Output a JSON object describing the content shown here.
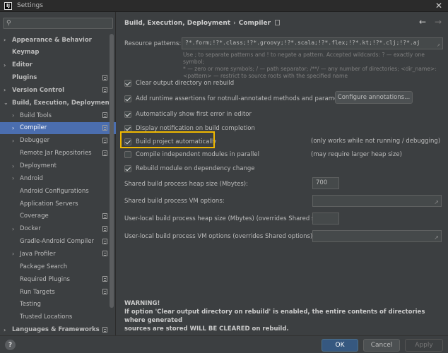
{
  "window": {
    "title": "Settings",
    "app_icon": "intellij-logo-icon",
    "app_icon_letter": "IJ",
    "close_glyph": "✕"
  },
  "sidebar": {
    "search_placeholder": "",
    "items": [
      {
        "label": "Appearance & Behavior",
        "bold": true,
        "arrow": "›"
      },
      {
        "label": "Keymap",
        "bold": true,
        "arrow": ""
      },
      {
        "label": "Editor",
        "bold": true,
        "arrow": "›"
      },
      {
        "label": "Plugins",
        "bold": true,
        "arrow": ""
      },
      {
        "label": "Version Control",
        "bold": true,
        "arrow": "›"
      },
      {
        "label": "Build, Execution, Deployment",
        "bold": true,
        "arrow": "⌄"
      },
      {
        "label": "Build Tools",
        "arrow": "›"
      },
      {
        "label": "Compiler",
        "arrow": "›",
        "selected": true
      },
      {
        "label": "Debugger",
        "arrow": "›"
      },
      {
        "label": "Remote Jar Repositories",
        "arrow": ""
      },
      {
        "label": "Deployment",
        "arrow": "›"
      },
      {
        "label": "Android",
        "arrow": "›"
      },
      {
        "label": "Android Configurations",
        "arrow": ""
      },
      {
        "label": "Application Servers",
        "arrow": ""
      },
      {
        "label": "Coverage",
        "arrow": ""
      },
      {
        "label": "Docker",
        "arrow": "›"
      },
      {
        "label": "Gradle-Android Compiler",
        "arrow": ""
      },
      {
        "label": "Java Profiler",
        "arrow": "›"
      },
      {
        "label": "Package Search",
        "arrow": ""
      },
      {
        "label": "Required Plugins",
        "arrow": ""
      },
      {
        "label": "Run Targets",
        "arrow": ""
      },
      {
        "label": "Testing",
        "arrow": ""
      },
      {
        "label": "Trusted Locations",
        "arrow": ""
      },
      {
        "label": "Languages & Frameworks",
        "bold": true,
        "arrow": "›"
      }
    ]
  },
  "header": {
    "crumb_parent": "Build, Execution, Deployment",
    "crumb_sep": "›",
    "crumb_current": "Compiler",
    "back_glyph": "←",
    "forward_glyph": "→"
  },
  "compiler": {
    "resource_patterns_label": "Resource patterns:",
    "resource_patterns_value": "?*.form;!?*.class;!?*.groovy;!?*.scala;!?*.flex;!?*.kt;!?*.clj;!?*.aj",
    "hint_line1": "Use ; to separate patterns and ! to negate a pattern. Accepted wildcards: ? — exactly one symbol;",
    "hint_line2": "* — zero or more symbols; / — path separator; /**/ — any number of directories; <dir_name>:",
    "hint_line3": "<pattern> — restrict to source roots with the specified name",
    "checkboxes": [
      {
        "label": "Clear output directory on rebuild",
        "checked": true
      },
      {
        "label": "Add runtime assertions for notnull-annotated methods and parameters",
        "checked": true
      },
      {
        "label": "Automatically show first error in editor",
        "checked": true
      },
      {
        "label": "Display notification on build completion",
        "checked": true
      },
      {
        "label": "Build project automatically",
        "checked": true
      },
      {
        "label": "Compile independent modules in parallel",
        "checked": false
      },
      {
        "label": "Rebuild module on dependency change",
        "checked": true
      }
    ],
    "configure_annotations_label": "Configure annotations...",
    "build_auto_note": "(only works while not running / debugging)",
    "parallel_note": "(may require larger heap size)",
    "heap_size_label": "Shared build process heap size (Mbytes):",
    "heap_size_value": "700",
    "vm_options_label": "Shared build process VM options:",
    "vm_options_value": "",
    "user_heap_label": "User-local build process heap size (Mbytes) (overrides Shared size):",
    "user_heap_value": "",
    "user_vm_label": "User-local build process VM options (overrides Shared options):",
    "user_vm_value": "",
    "warning_title": "WARNING!",
    "warning_line1": "If option 'Clear output directory on rebuild' is enabled, the entire contents of directories where generated",
    "warning_line2": "sources are stored WILL BE CLEARED on rebuild."
  },
  "footer": {
    "help": "?",
    "ok": "OK",
    "cancel": "Cancel",
    "apply": "Apply"
  },
  "colors": {
    "background": "#3c3f41",
    "selection": "#4b6eaf",
    "highlight": "#f0b800",
    "primary_button": "#365880"
  }
}
